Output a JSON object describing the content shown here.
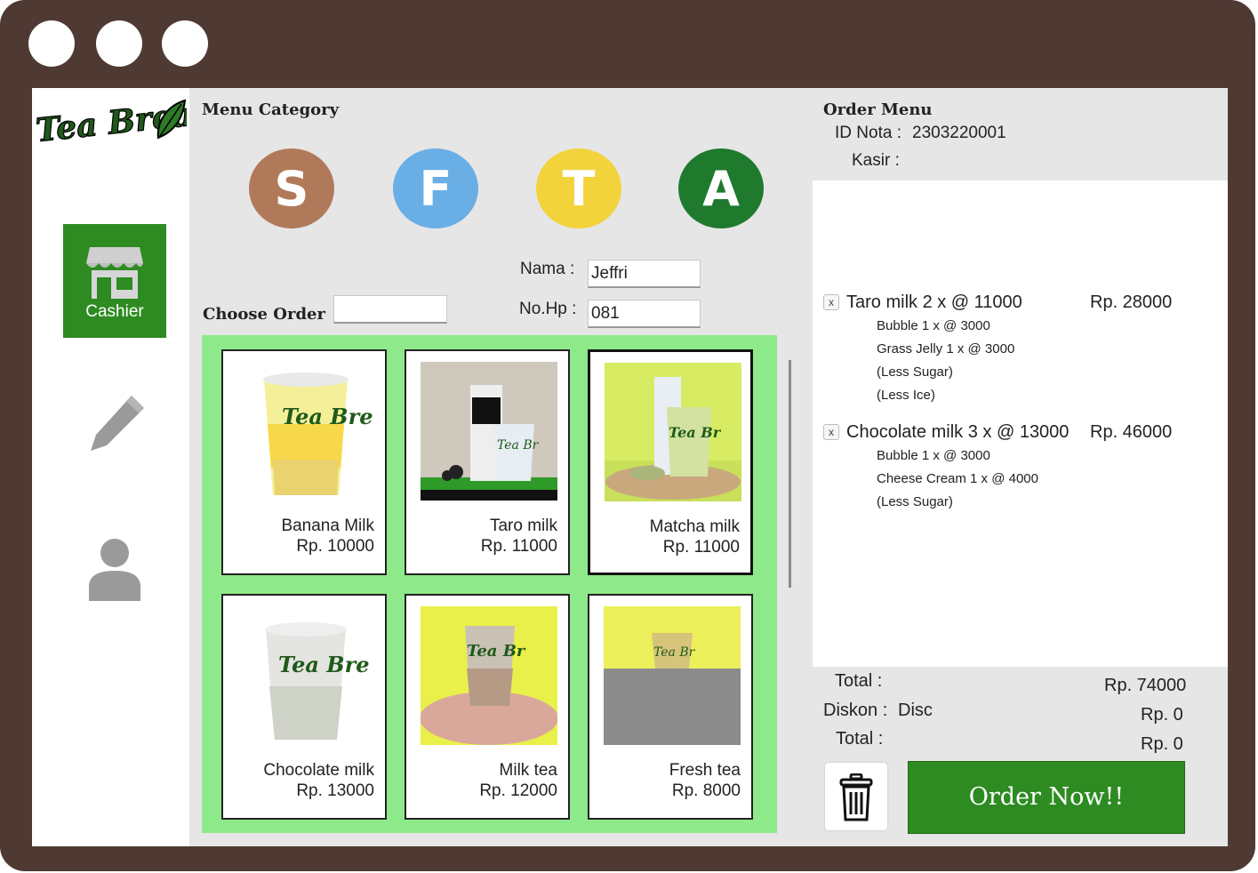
{
  "app": {
    "name": "Tea Break"
  },
  "sidebar": {
    "cashier_label": "Cashier"
  },
  "menu": {
    "category_title": "Menu Category",
    "categories": [
      {
        "letter": "S",
        "color": "#b07a5a"
      },
      {
        "letter": "F",
        "color": "#6aaee6"
      },
      {
        "letter": "T",
        "color": "#f2d33c"
      },
      {
        "letter": "A",
        "color": "#1f7a2e"
      }
    ],
    "choose_label": "Choose Order",
    "choose_value": ""
  },
  "customer": {
    "name_label": "Nama :",
    "name_value": "Jeffri",
    "phone_label": "No.Hp :",
    "phone_value": "081"
  },
  "products": [
    {
      "name": "Banana Milk",
      "price": "Rp. 10000"
    },
    {
      "name": "Taro milk",
      "price": "Rp. 11000"
    },
    {
      "name": "Matcha milk",
      "price": "Rp. 11000",
      "selected": true
    },
    {
      "name": "Chocolate milk",
      "price": "Rp. 13000"
    },
    {
      "name": "Milk tea",
      "price": "Rp. 12000"
    },
    {
      "name": "Fresh tea",
      "price": "Rp. 8000"
    }
  ],
  "order": {
    "title": "Order Menu",
    "id_label": "ID Nota :",
    "id_value": "2303220001",
    "cashier_label": "Kasir :",
    "items": [
      {
        "remove": "x",
        "name": "Taro milk 2 x @ 11000",
        "price": "Rp. 28000",
        "details": [
          "Bubble 1 x @ 3000",
          "Grass Jelly 1 x @ 3000",
          "(Less Sugar)",
          "(Less Ice)"
        ]
      },
      {
        "remove": "x",
        "name": "Chocolate milk 3 x @ 13000",
        "price": "Rp. 46000",
        "details": [
          "Bubble 1 x @ 3000",
          "Cheese Cream 1 x @ 4000",
          "(Less Sugar)"
        ]
      }
    ],
    "total_label": "Total :",
    "total_value": "Rp. 74000",
    "discount_label": "Diskon :",
    "discount_code": "Disc",
    "discount_value": "Rp. 0",
    "grand_total_label": "Total :",
    "grand_total_value": "Rp. 0",
    "order_button": "Order Now!!"
  },
  "colors": {
    "frame": "#4f3a33",
    "accent_green": "#2e8b22",
    "grid_green": "#8ee98b"
  }
}
